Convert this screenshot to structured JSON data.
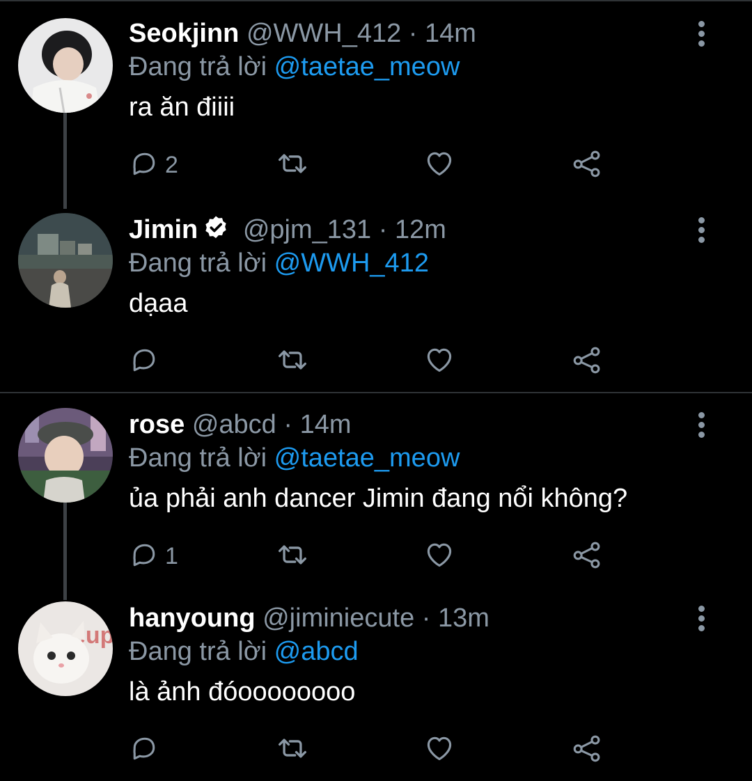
{
  "reply_prefix": "Đang trả lời",
  "colors": {
    "background": "#000000",
    "name": "#ffffff",
    "muted": "#8b98a5",
    "mention": "#1d9bf0",
    "divider": "#2f3336"
  },
  "icons": [
    "reply-icon",
    "retweet-icon",
    "like-icon",
    "share-icon",
    "more-icon",
    "verified-badge-icon"
  ],
  "tweets": [
    {
      "name": "Seokjinn",
      "handle": "@WWH_412",
      "separator": "·",
      "time": "14m",
      "reply_to": "@taetae_meow",
      "text": "ra ăn điiii",
      "reply_count": "2",
      "verified": false
    },
    {
      "name": "Jimin",
      "handle": "@pjm_131",
      "separator": "·",
      "time": "12m",
      "reply_to": "@WWH_412",
      "text": "dạaa",
      "reply_count": "",
      "verified": true
    },
    {
      "name": "rose",
      "handle": "@abcd",
      "separator": "·",
      "time": "14m",
      "reply_to": "@taetae_meow",
      "text": "ủa phải anh dancer Jimin đang nổi không?",
      "reply_count": "1",
      "verified": false
    },
    {
      "name": "hanyoung",
      "handle": "@jiminiecute",
      "separator": "·",
      "time": "13m",
      "reply_to": "@abcd",
      "text": "là ảnh đóoooooooo",
      "reply_count": "",
      "verified": false
    }
  ]
}
